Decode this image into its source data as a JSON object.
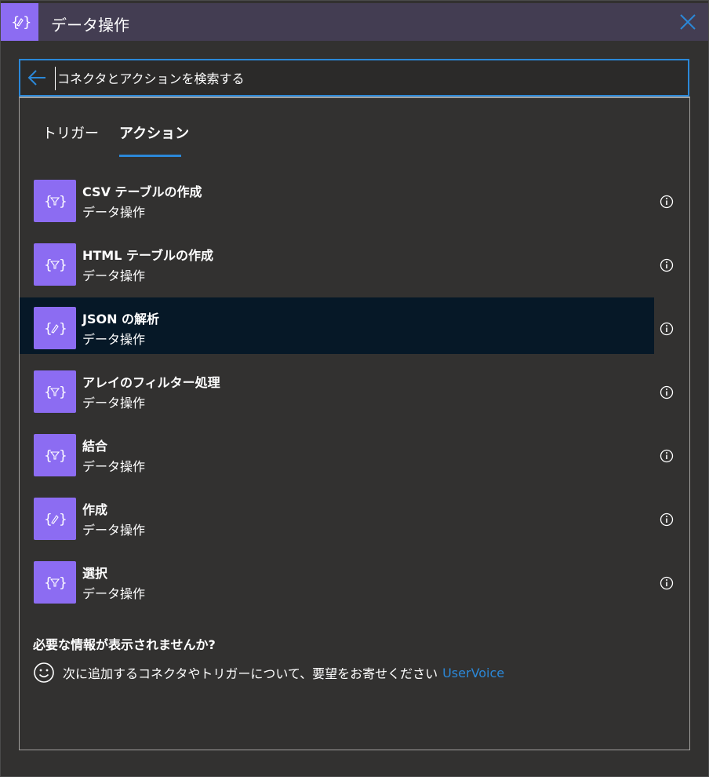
{
  "header": {
    "title": "データ操作",
    "icon": "data-operation-icon",
    "accent": "#8c6cf2",
    "background": "#433d52"
  },
  "search": {
    "placeholder": "コネクタとアクションを検索する",
    "value": "",
    "border_color": "#2b88d8"
  },
  "tabs": [
    {
      "label": "トリガー",
      "selected": false
    },
    {
      "label": "アクション",
      "selected": true
    }
  ],
  "actions": [
    {
      "title": "CSV テーブルの作成",
      "connector": "データ操作",
      "icon": "filter-braces-icon",
      "selected": false
    },
    {
      "title": "HTML テーブルの作成",
      "connector": "データ操作",
      "icon": "filter-braces-icon",
      "selected": false
    },
    {
      "title": "JSON の解析",
      "connector": "データ操作",
      "icon": "pencil-braces-icon",
      "selected": true
    },
    {
      "title": "アレイのフィルター処理",
      "connector": "データ操作",
      "icon": "filter-braces-icon",
      "selected": false
    },
    {
      "title": "結合",
      "connector": "データ操作",
      "icon": "filter-braces-icon",
      "selected": false
    },
    {
      "title": "作成",
      "connector": "データ操作",
      "icon": "pencil-braces-icon",
      "selected": false
    },
    {
      "title": "選択",
      "connector": "データ操作",
      "icon": "filter-braces-icon",
      "selected": false
    }
  ],
  "feedback": {
    "question": "必要な情報が表示されませんか?",
    "message": "次に追加するコネクタやトリガーについて、要望をお寄せください",
    "link_label": "UserVoice",
    "link_color": "#2b88d8"
  }
}
